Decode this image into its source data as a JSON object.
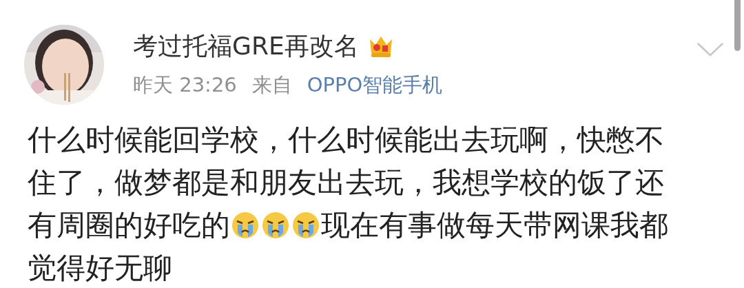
{
  "author": {
    "name": "考过托福GRE再改名",
    "badge": {
      "kind": "crown"
    }
  },
  "meta": {
    "time": "昨天 23:26",
    "source_prefix": "来自",
    "source": "OPPO智能手机"
  },
  "body_lines": [
    [
      {
        "kind": "text",
        "text": "什么时候能回学校，什么时候能出去玩啊，快憋不"
      }
    ],
    [
      {
        "kind": "text",
        "text": "住了，做梦都是和朋友出去玩，我想学校的饭了还"
      }
    ],
    [
      {
        "kind": "text",
        "text": "有周圈的好吃的"
      },
      {
        "kind": "emoji"
      },
      {
        "kind": "emoji"
      },
      {
        "kind": "emoji"
      },
      {
        "kind": "text",
        "text": " 现在有事做每天带网课我都"
      }
    ],
    [
      {
        "kind": "text",
        "text": "觉得好无聊"
      }
    ]
  ]
}
